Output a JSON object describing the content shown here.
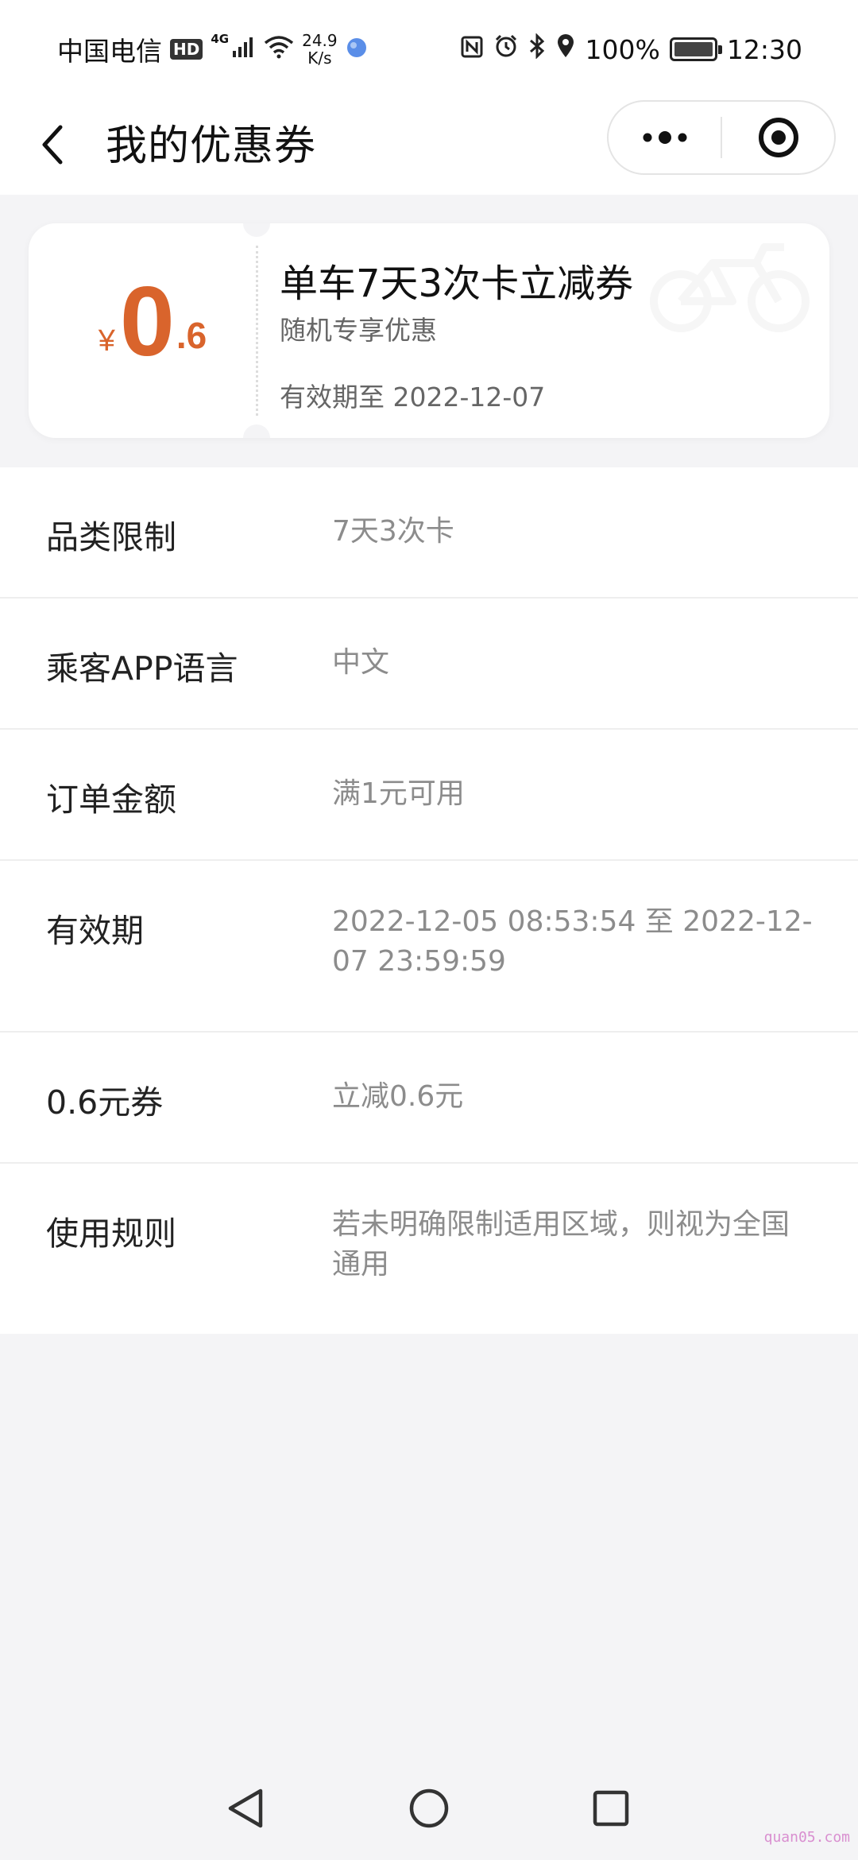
{
  "status_bar": {
    "carrier": "中国电信",
    "hd": "HD",
    "network": "4G",
    "speed_value": "24.9",
    "speed_unit": "K/s",
    "battery": "100%",
    "time": "12:30"
  },
  "nav": {
    "title": "我的优惠券"
  },
  "coupon": {
    "currency": "¥",
    "amount_int": "0",
    "amount_dec": ".6",
    "title": "单车7天3次卡立减券",
    "subtitle": "随机专享优惠",
    "expiry": "有效期至 2022-12-07",
    "accent_color": "#d9642c"
  },
  "details": [
    {
      "label": "品类限制",
      "value": "7天3次卡"
    },
    {
      "label": "乘客APP语言",
      "value": "中文"
    },
    {
      "label": "订单金额",
      "value": "满1元可用"
    },
    {
      "label": "有效期",
      "value": "2022-12-05 08:53:54 至 2022-12-07 23:59:59"
    },
    {
      "label": "0.6元券",
      "value": "立减0.6元"
    },
    {
      "label": "使用规则",
      "value": "若未明确限制适用区域，则视为全国通用"
    }
  ],
  "watermark": "quan05.com"
}
